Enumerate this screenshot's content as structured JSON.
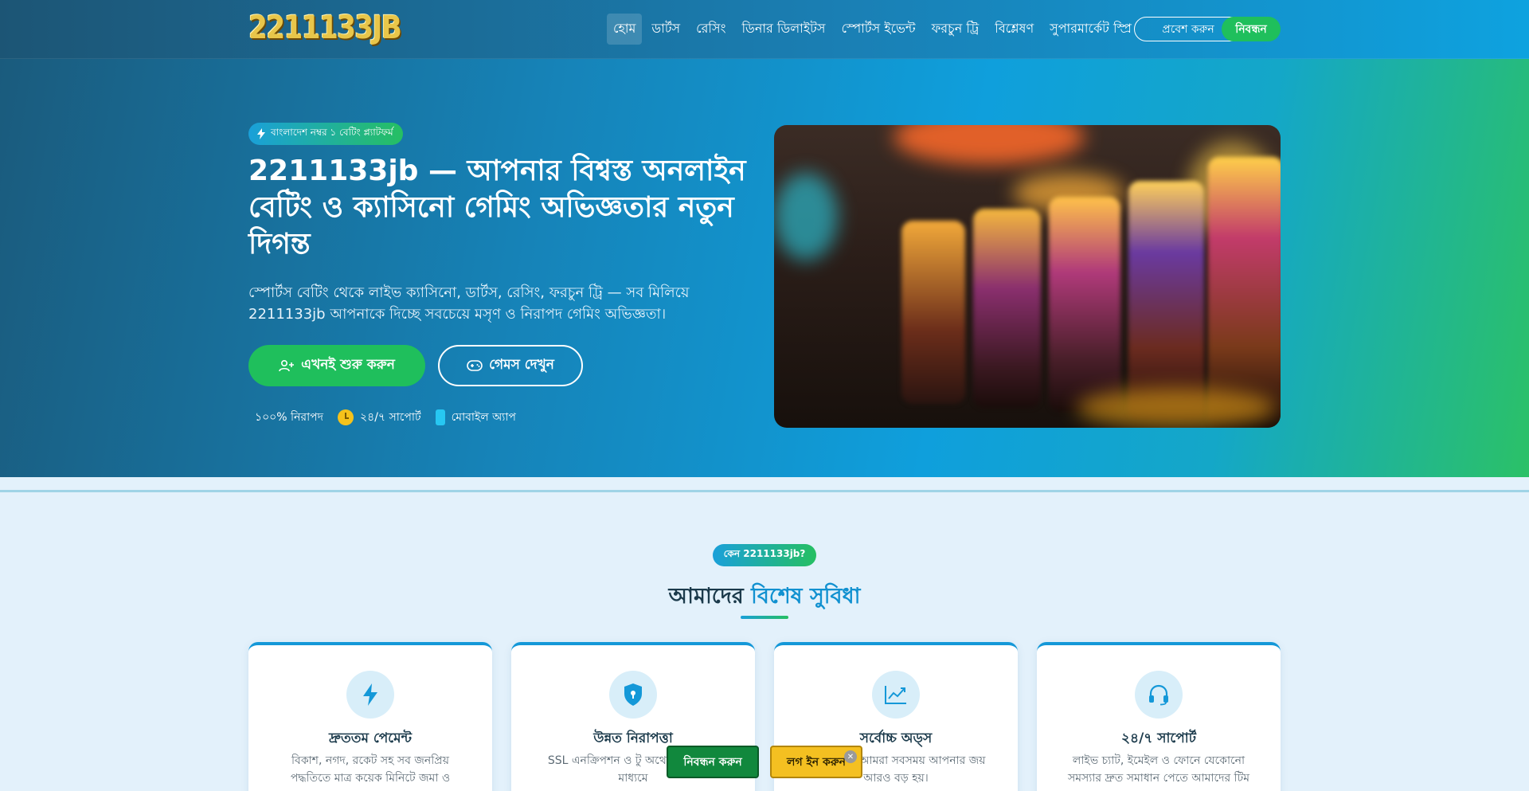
{
  "header": {
    "logo": "2211133JB",
    "nav": [
      {
        "label": "হোম",
        "active": true
      },
      {
        "label": "ডার্টস",
        "active": false
      },
      {
        "label": "রেসিং",
        "active": false
      },
      {
        "label": "ডিনার ডিলাইটস",
        "active": false
      },
      {
        "label": "স্পোর্টস ইভেন্ট",
        "active": false
      },
      {
        "label": "ফরচুন ট্রি",
        "active": false
      },
      {
        "label": "বিশ্লেষণ",
        "active": false
      },
      {
        "label": "সুপারমার্কেট স্প্রি",
        "active": false
      }
    ],
    "login_label": "প্রবেশ করুন",
    "register_label": "নিবন্ধন"
  },
  "hero": {
    "badge": "বাংলাদেশ নম্বর ১ বেটিং প্ল্যাটফর্ম",
    "title": "2211133jb — আপনার বিশ্বস্ত অনলাইন বেটিং ও ক্যাসিনো গেমিং অভিজ্ঞতার নতুন দিগন্ত",
    "subtitle": "স্পোর্টস বেটিং থেকে লাইভ ক্যাসিনো, ডার্টস, রেসিং, ফরচুন ট্রি — সব মিলিয়ে 2211133jb আপনাকে দিচ্ছে সবচেয়ে মসৃণ ও নিরাপদ গেমিং অভিজ্ঞতা।",
    "cta_primary": "এখনই শুরু করুন",
    "cta_secondary": "গেমস দেখুন",
    "trust": {
      "secure": "১০০% নিরাপদ",
      "support": "২৪/৭ সাপোর্ট",
      "mobile": "মোবাইল অ্যাপ"
    }
  },
  "features": {
    "pill": "কেন 2211133jb?",
    "title_plain": "আমাদের",
    "title_highlight": "বিশেষ সুবিধা",
    "cards": [
      {
        "icon": "lightning-icon",
        "title": "দ্রুততম পেমেন্ট",
        "desc": "বিকাশ, নগদ, রকেট সহ সব জনপ্রিয় পদ্ধতিতে মাত্র কয়েক মিনিটে জমা ও"
      },
      {
        "icon": "shield-icon",
        "title": "উন্নত নিরাপত্তা",
        "desc": "SSL এনক্রিপশন ও টু অথেনটিকেশনের মাধ্যমে"
      },
      {
        "icon": "chart-icon",
        "title": "সর্বোচ্চ অড্স",
        "desc": "অড্স নিয়ে আমরা সবসময় আপনার জয় আরও বড় হয়।"
      },
      {
        "icon": "headset-icon",
        "title": "২৪/৭ সাপোর্ট",
        "desc": "লাইভ চ্যাট, ইমেইল ও ফোনে যেকোনো সমস্যার দ্রুত সমাধান পেতে আমাদের টিম"
      }
    ]
  },
  "floating": {
    "register": "নিবন্ধন করুন",
    "login": "লগ ইন করুন",
    "close": "✕"
  },
  "colors": {
    "accent_green": "#1fbf5c",
    "accent_blue": "#1498d8",
    "header_dark": "#1c5575"
  }
}
